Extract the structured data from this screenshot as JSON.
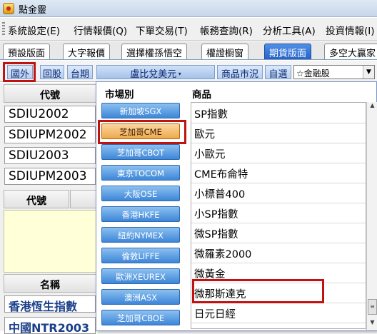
{
  "window": {
    "title": "點金靈"
  },
  "menu": [
    "系統設定(E)",
    "行情報價(Q)",
    "下單交易(T)",
    "帳務查詢(R)",
    "分析工具(A)",
    "投資情報(I)"
  ],
  "tabs": [
    {
      "label": "預設版面",
      "active": false
    },
    {
      "label": "大字報價",
      "active": false
    },
    {
      "label": "選擇權孫悟空",
      "active": false
    },
    {
      "label": "權證橱窗",
      "active": false
    },
    {
      "label": "期貨版面",
      "active": true
    },
    {
      "label": "多空大贏家",
      "active": false
    }
  ],
  "toolbar": {
    "foreign_label": "國外",
    "domestic_stock_label": "回股",
    "domestic_futures_label": "台期",
    "currency_dropdown": "盧比兌美元",
    "commodity_market_label": "商品市況",
    "watchlist_label": "自選",
    "stock_select_value": "☆金融股"
  },
  "left_panel": {
    "code_header": "代號",
    "codes": [
      "SDIU2002",
      "SDIUPM2002",
      "SDIU2003",
      "SDIUPM2003"
    ],
    "code_header_2": "代號",
    "name_header": "名稱",
    "names": [
      "香港恆生指數",
      "中國NTR2003"
    ]
  },
  "popup": {
    "market_header": "市場別",
    "product_header": "商品",
    "markets": [
      {
        "label": "新加坡SGX",
        "selected": false
      },
      {
        "label": "芝加哥CME",
        "selected": true
      },
      {
        "label": "芝加哥CBOT",
        "selected": false
      },
      {
        "label": "東京TOCOM",
        "selected": false
      },
      {
        "label": "大阪OSE",
        "selected": false
      },
      {
        "label": "香港HKFE",
        "selected": false
      },
      {
        "label": "紐約NYMEX",
        "selected": false
      },
      {
        "label": "倫敦LIFFE",
        "selected": false
      },
      {
        "label": "歐洲XEUREX",
        "selected": false
      },
      {
        "label": "澳洲ASX",
        "selected": false
      },
      {
        "label": "芝加哥CBOE",
        "selected": false
      }
    ],
    "products": [
      "SP指數",
      "歐元",
      "小歐元",
      "CME布侖特",
      "小標普400",
      "小SP指數",
      "微SP指數",
      "微羅素2000",
      "微黃金",
      "微那斯達克",
      "日元日經"
    ]
  }
}
